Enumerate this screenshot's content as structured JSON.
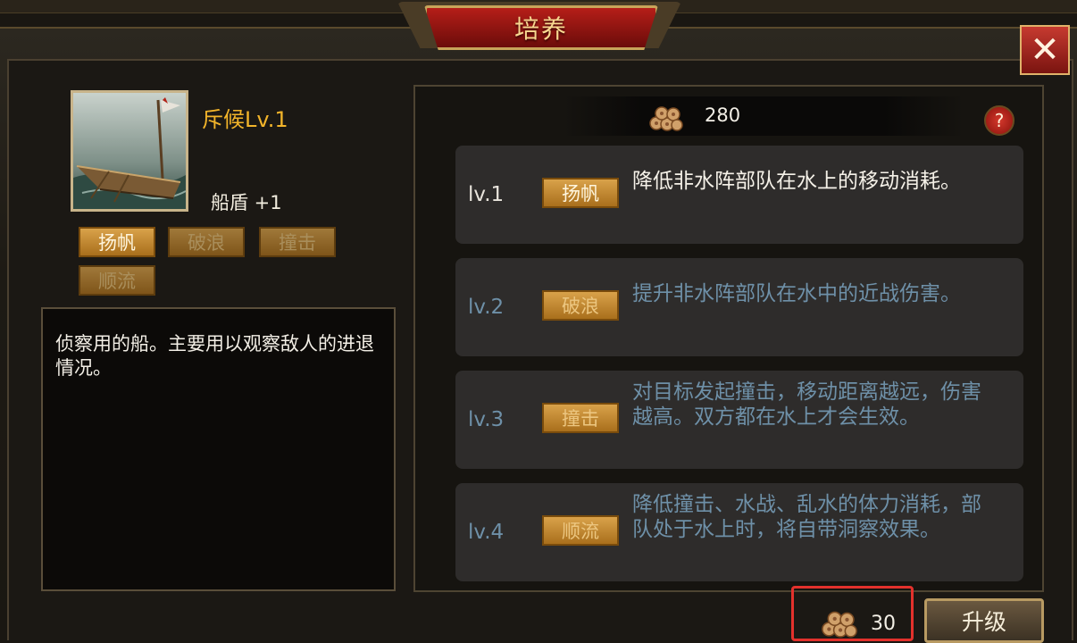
{
  "header": {
    "title": "培养",
    "close_icon": "close-icon",
    "close_glyph": "✕"
  },
  "unit": {
    "name": "斥候Lv.1",
    "stat": "船盾 +1",
    "skills": [
      "扬帆",
      "破浪",
      "撞击",
      "顺流"
    ],
    "description": "侦察用的船。主要用以观察敌人的进退情况。"
  },
  "resource": {
    "icon": "wood-icon",
    "amount": "280",
    "help_glyph": "?"
  },
  "levels": [
    {
      "level": "lv.1",
      "skill": "扬帆",
      "desc": "降低非水阵部队在水上的移动消耗。",
      "unlocked": true
    },
    {
      "level": "lv.2",
      "skill": "破浪",
      "desc": "提升非水阵部队在水中的近战伤害。",
      "unlocked": false
    },
    {
      "level": "lv.3",
      "skill": "撞击",
      "desc": "对目标发起撞击，移动距离越远，伤害越高。双方都在水上才会生效。",
      "unlocked": false
    },
    {
      "level": "lv.4",
      "skill": "顺流",
      "desc": "降低撞击、水战、乱水的体力消耗，部队处于水上时，将自带洞察效果。",
      "unlocked": false
    }
  ],
  "upgrade": {
    "cost": "30",
    "cost_icon": "wood-icon",
    "label": "升级"
  },
  "colors": {
    "accent_gold": "#f2b42a",
    "locked_text": "#6e90a8",
    "highlight": "#e3312c"
  }
}
